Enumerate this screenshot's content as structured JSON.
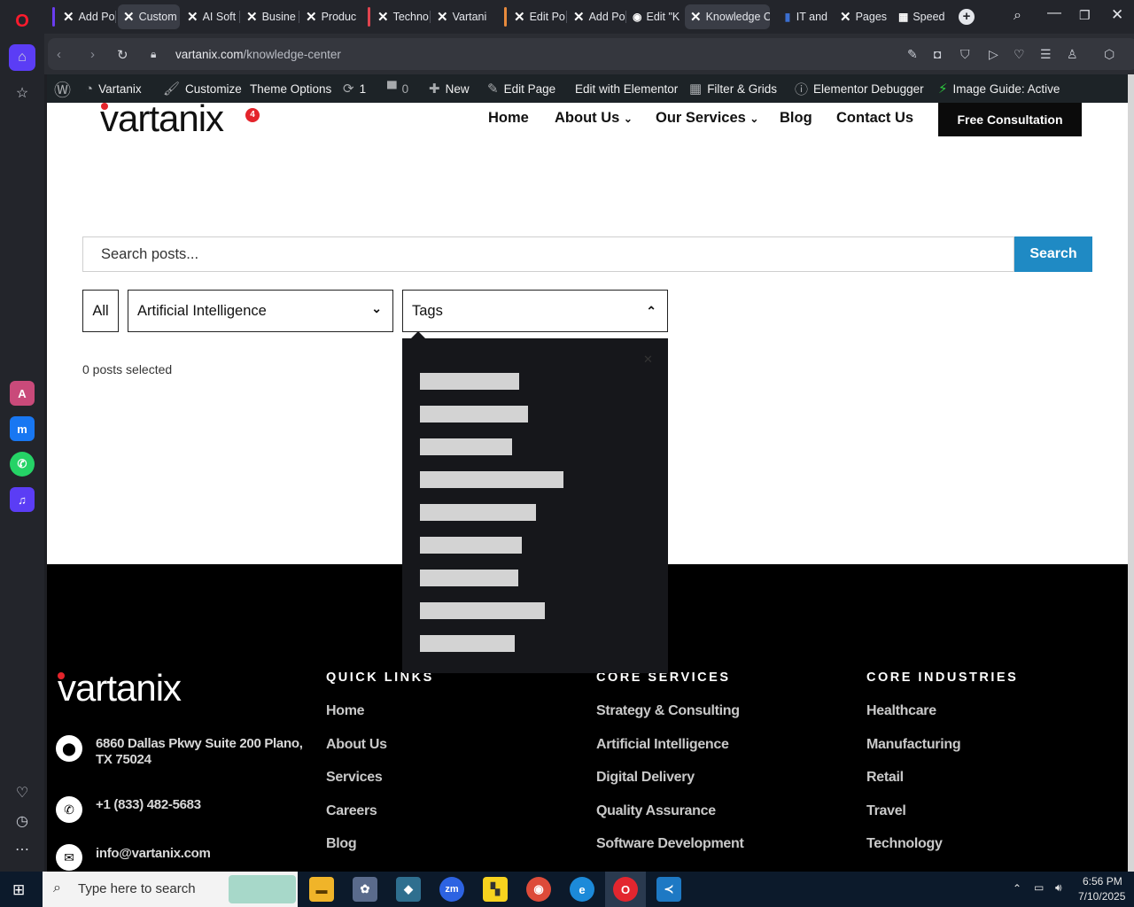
{
  "browser": {
    "tabs": [
      {
        "label": "Add Po"
      },
      {
        "label": "Custom"
      },
      {
        "label": "AI Soft"
      },
      {
        "label": "Busine"
      },
      {
        "label": "Produc"
      },
      {
        "label": "Techno"
      },
      {
        "label": "Vartani"
      },
      {
        "label": "Edit Po"
      },
      {
        "label": "Add Po"
      },
      {
        "label": "Edit \"K"
      },
      {
        "label": "Knowledge C"
      },
      {
        "label": "IT and"
      },
      {
        "label": "Pages"
      },
      {
        "label": "Speed"
      }
    ],
    "url_host": "vartanix.com",
    "url_path": "/knowledge-center"
  },
  "wp_admin_bar": {
    "site_name": "Vartanix",
    "customize": "Customize",
    "theme_options": "Theme Options",
    "updates_count": "1",
    "comments_count": "0",
    "new": "New",
    "edit_page": "Edit Page",
    "edit_elementor": "Edit with Elementor",
    "filter_grids": "Filter & Grids",
    "elementor_debugger": "Elementor Debugger",
    "image_guide": "Image Guide: Active",
    "notification_badge": "4"
  },
  "header": {
    "logo_text": "vartanix",
    "nav": {
      "home": "Home",
      "about": "About Us",
      "services": "Our Services",
      "blog": "Blog",
      "contact": "Contact Us"
    },
    "cta_label": "Free Consultation"
  },
  "knowledge_center": {
    "search_placeholder": "Search posts...",
    "search_button": "Search",
    "filter_all": "All",
    "category_selected": "Artificial Intelligence",
    "tags_label": "Tags",
    "posts_selected": "0 posts selected"
  },
  "footer": {
    "logo_text": "vartanix",
    "address_line1": "6860 Dallas Pkwy Suite 200 Plano,",
    "address_line2": "TX 75024",
    "phone": "+1 (833) 482-5683",
    "email": "info@vartanix.com",
    "quick_links_title": "QUICK LINKS",
    "quick_links": [
      "Home",
      "About Us",
      "Services",
      "Careers",
      "Blog"
    ],
    "core_services_title": "CORE SERVICES",
    "core_services": [
      "Strategy & Consulting",
      "Artificial Intelligence",
      "Digital Delivery",
      "Quality Assurance",
      "Software Development"
    ],
    "core_industries_title": "CORE INDUSTRIES",
    "core_industries": [
      "Healthcare",
      "Manufacturing",
      "Retail",
      "Travel",
      "Technology"
    ]
  },
  "taskbar": {
    "search_placeholder": "Type here to search",
    "time": "6:56 PM",
    "date": "7/10/2025"
  },
  "colors": {
    "accent_blue": "#1f8ac4",
    "brand_red": "#e4242b",
    "brand_blue": "#2d7ff9",
    "opera_red": "#e3262f"
  }
}
